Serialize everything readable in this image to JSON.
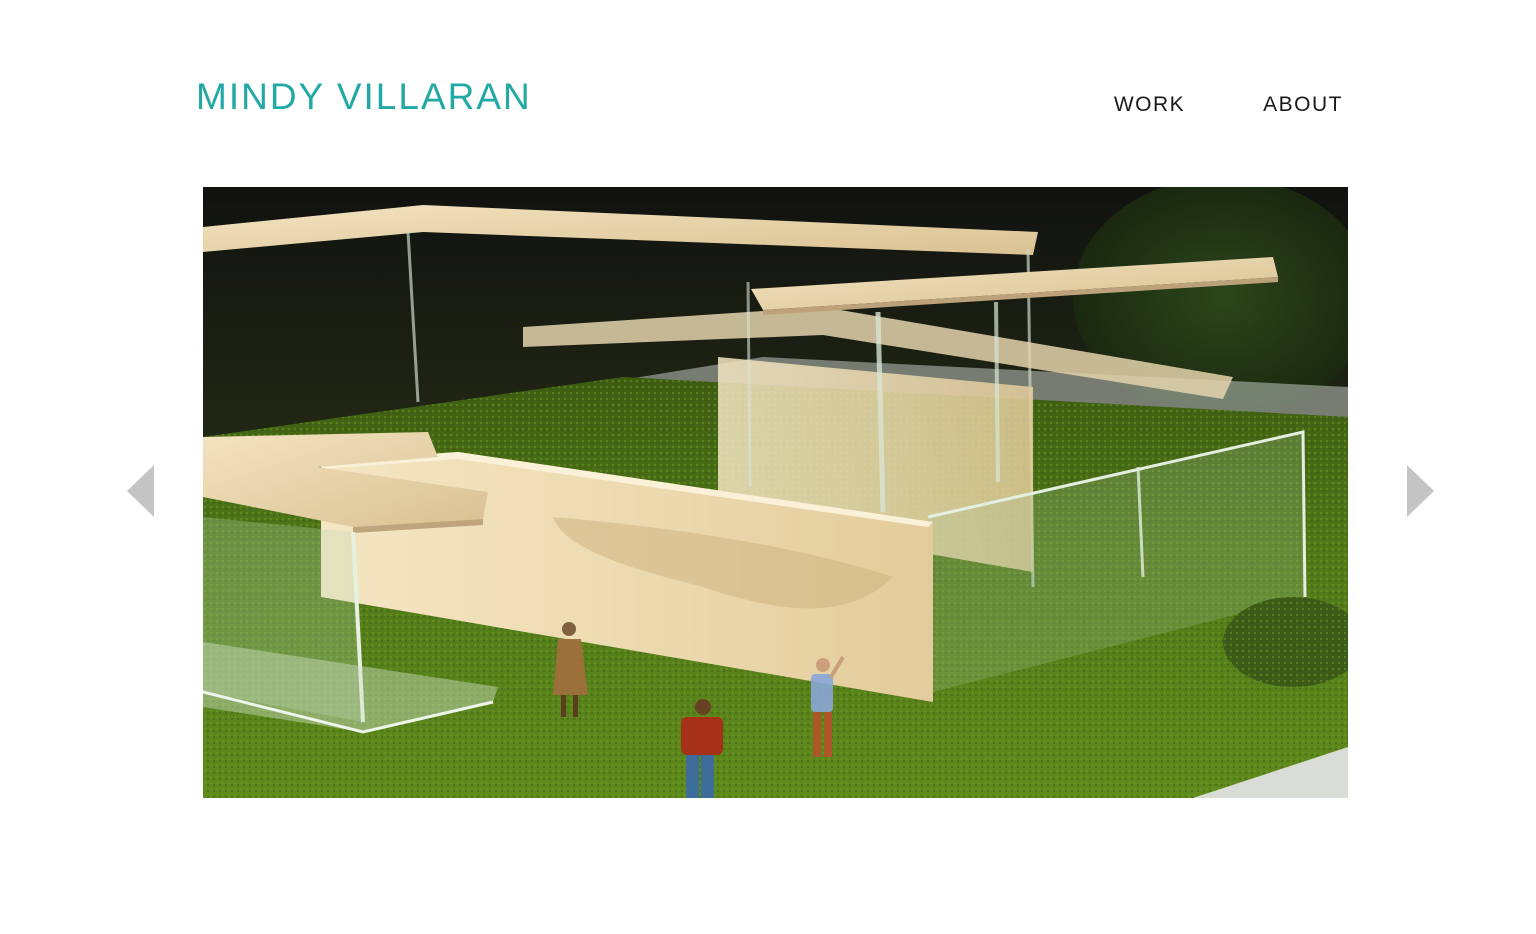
{
  "header": {
    "site_title": "MINDY VILLARAN",
    "title_color": "#22a9a6"
  },
  "nav": {
    "items": [
      {
        "label": "WORK"
      },
      {
        "label": "ABOUT"
      }
    ]
  },
  "slideshow": {
    "prev_icon": "triangle-left-icon",
    "next_icon": "triangle-right-icon",
    "arrow_color": "#c4c4c4",
    "image_subject": "architectural-model-photo"
  }
}
